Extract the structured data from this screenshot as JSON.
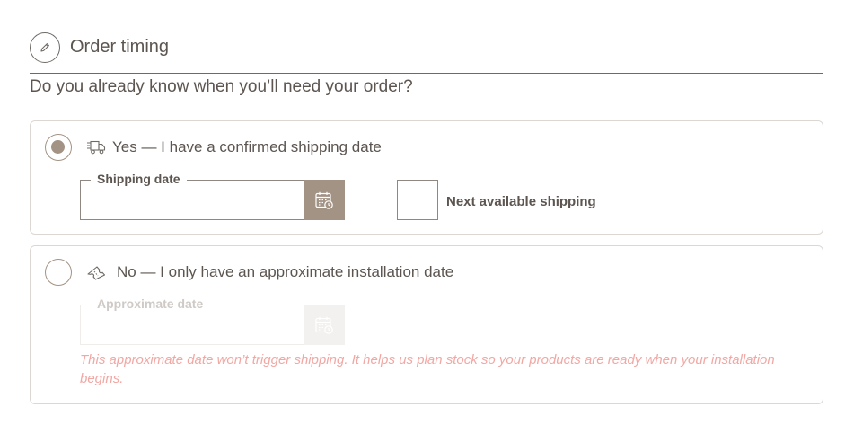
{
  "section": {
    "title": "Order timing",
    "icon": "pencil-icon"
  },
  "question": "Do you already know when you’ll need your order?",
  "options": [
    {
      "id": "yes",
      "checked": true,
      "icon": "delivery-truck-icon",
      "label": "Yes — I have a confirmed shipping date",
      "field_label": "Shipping date",
      "field_value": "",
      "checkbox_label": "Next available shipping",
      "checkbox_checked": false
    },
    {
      "id": "no",
      "checked": false,
      "icon": "ticket-icon",
      "label": "No — I only have an approximate installation date",
      "field_label": "Approximate date",
      "field_value": "",
      "disabled": true,
      "hint": "This approximate date won’t trigger shipping. It helps us plan stock so your products are ready when your installation begins."
    }
  ],
  "colors": {
    "accent": "#a39384",
    "text": "#5c5550",
    "hint": "#f1a8a4",
    "border": "#dcd7d3"
  }
}
